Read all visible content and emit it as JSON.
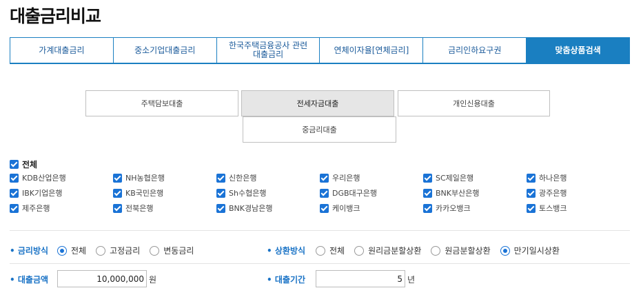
{
  "title": "대출금리비교",
  "tabs": [
    {
      "label": "가계대출금리",
      "active": false
    },
    {
      "label": "중소기업대출금리",
      "active": false
    },
    {
      "label": "한국주택금융공사 관련\n대출금리",
      "active": false
    },
    {
      "label": "연체이자율[연체금리]",
      "active": false
    },
    {
      "label": "금리인하요구권",
      "active": false
    },
    {
      "label": "맞춤상품검색",
      "active": true
    }
  ],
  "subtabs": [
    {
      "label": "주택담보대출",
      "active": false
    },
    {
      "label": "전세자금대출",
      "active": true
    },
    {
      "label": "개인신용대출",
      "active": false
    },
    {
      "label": "중금리대출",
      "active": false
    }
  ],
  "select_all": {
    "label": "전체",
    "checked": true
  },
  "banks": [
    {
      "label": "KDB산업은행",
      "checked": true
    },
    {
      "label": "NH농협은행",
      "checked": true
    },
    {
      "label": "신한은행",
      "checked": true
    },
    {
      "label": "우리은행",
      "checked": true
    },
    {
      "label": "SC제일은행",
      "checked": true
    },
    {
      "label": "하나은행",
      "checked": true
    },
    {
      "label": "IBK기업은행",
      "checked": true
    },
    {
      "label": "KB국민은행",
      "checked": true
    },
    {
      "label": "Sh수협은행",
      "checked": true
    },
    {
      "label": "DGB대구은행",
      "checked": true
    },
    {
      "label": "BNK부산은행",
      "checked": true
    },
    {
      "label": "광주은행",
      "checked": true
    },
    {
      "label": "제주은행",
      "checked": true
    },
    {
      "label": "전북은행",
      "checked": true
    },
    {
      "label": "BNK경남은행",
      "checked": true
    },
    {
      "label": "케이뱅크",
      "checked": true
    },
    {
      "label": "카카오뱅크",
      "checked": true
    },
    {
      "label": "토스뱅크",
      "checked": true
    }
  ],
  "rate_method": {
    "label": "금리방식",
    "options": [
      {
        "label": "전체",
        "selected": true
      },
      {
        "label": "고정금리",
        "selected": false
      },
      {
        "label": "변동금리",
        "selected": false
      }
    ]
  },
  "repay_method": {
    "label": "상환방식",
    "options": [
      {
        "label": "전체",
        "selected": false
      },
      {
        "label": "원리금분할상환",
        "selected": false
      },
      {
        "label": "원금분할상환",
        "selected": false
      },
      {
        "label": "만기일시상환",
        "selected": true
      }
    ]
  },
  "loan_amount": {
    "label": "대출금액",
    "value": "10,000,000",
    "unit": "원"
  },
  "loan_period": {
    "label": "대출기간",
    "value": "5",
    "unit": "년"
  },
  "colors": {
    "accent": "#1a7fc1",
    "checkbox": "#1a73d6",
    "label_blue": "#1a73c6"
  }
}
